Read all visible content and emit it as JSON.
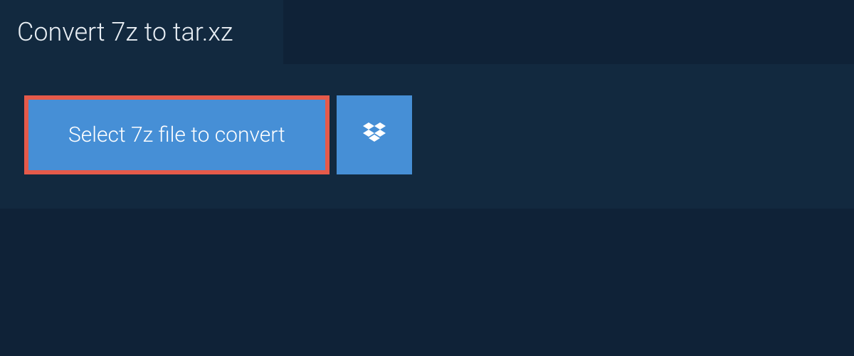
{
  "header": {
    "title": "Convert 7z to tar.xz"
  },
  "main": {
    "select_button_label": "Select 7z file to convert",
    "dropbox_icon_name": "dropbox-icon"
  },
  "colors": {
    "page_bg": "#0f2237",
    "panel_bg": "#12293f",
    "button_bg": "#468fd6",
    "highlight_border": "#e55a4a",
    "text_light": "#e8eef4",
    "text_white": "#ffffff"
  }
}
